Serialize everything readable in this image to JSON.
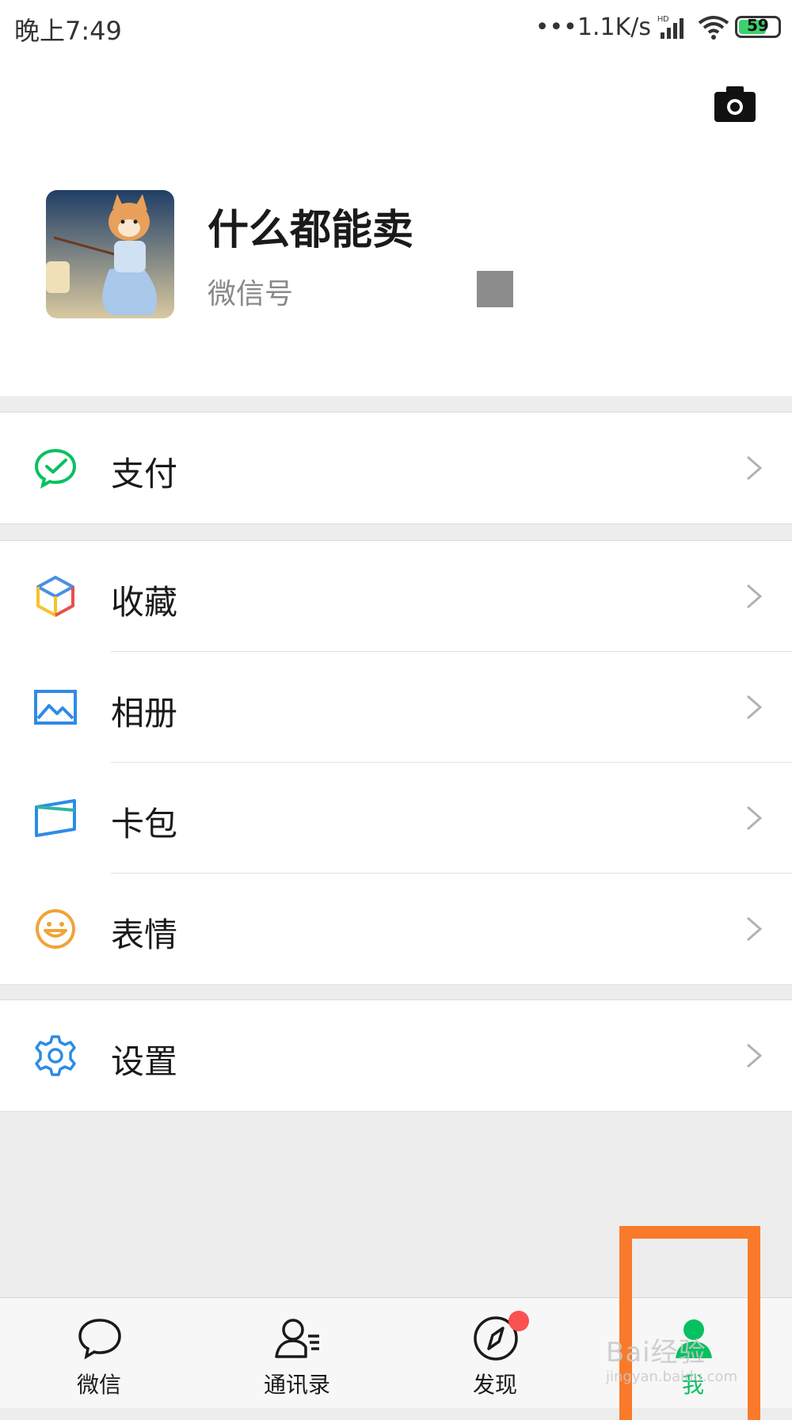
{
  "status_bar": {
    "time": "晚上7:49",
    "speed": "•••1.1K/s",
    "battery": "59"
  },
  "profile": {
    "nickname": "什么都能卖",
    "wechat_id_label": "微信号"
  },
  "menu": {
    "pay": "支付",
    "favorites": "收藏",
    "album": "相册",
    "cards": "卡包",
    "stickers": "表情",
    "settings": "设置"
  },
  "tabbar": {
    "chats": "微信",
    "contacts": "通讯录",
    "discover": "发现",
    "me": "我"
  },
  "watermark": {
    "main": "Bai经验",
    "sub": "jingyan.baidu.com"
  },
  "colors": {
    "accent": "#07c160",
    "highlight": "#f97a2a",
    "badge": "#fa5151"
  }
}
